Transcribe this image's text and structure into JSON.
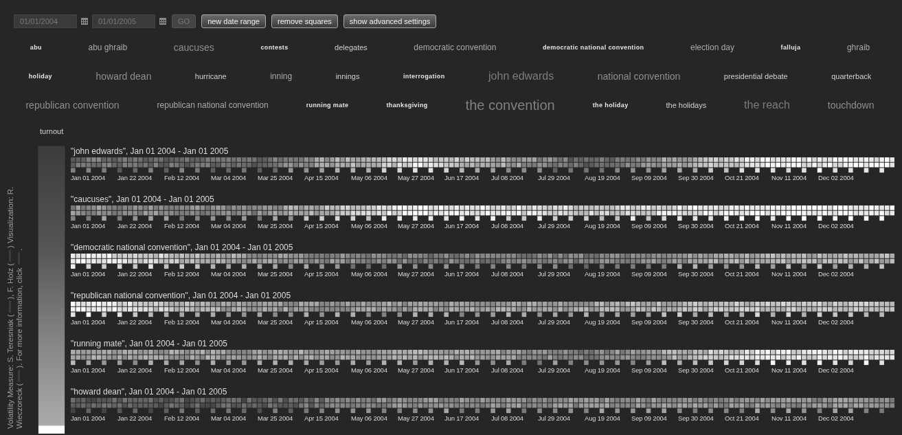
{
  "date_bar": {
    "start_date": "01/01/2004",
    "end_date": "01/01/2005",
    "go_button": {
      "label": "GO",
      "disabled": true
    },
    "buttons": [
      "new date range",
      "remove squares",
      "show advanced settings"
    ]
  },
  "tag_rows": [
    [
      {
        "label": "abu",
        "kind": "strong"
      },
      {
        "label": "abu ghraib",
        "kind": "plain"
      },
      {
        "label": "caucuses",
        "kind": "faint"
      },
      {
        "label": "contests",
        "kind": "strong"
      },
      {
        "label": "delegates",
        "kind": "light"
      },
      {
        "label": "democratic convention",
        "kind": "plain"
      },
      {
        "label": "democratic national convention",
        "kind": "strong"
      },
      {
        "label": "election day",
        "kind": "plain"
      },
      {
        "label": "falluja",
        "kind": "strong"
      },
      {
        "label": "ghraib",
        "kind": "plain"
      }
    ],
    [
      {
        "label": "holiday",
        "kind": "strong"
      },
      {
        "label": "howard dean",
        "kind": "faint"
      },
      {
        "label": "hurricane",
        "kind": "light"
      },
      {
        "label": "inning",
        "kind": "plain"
      },
      {
        "label": "innings",
        "kind": "light"
      },
      {
        "label": "interrogation",
        "kind": "strong"
      },
      {
        "label": "john edwards",
        "kind": "large"
      },
      {
        "label": "national convention",
        "kind": "faint"
      },
      {
        "label": "presidential debate",
        "kind": "light"
      },
      {
        "label": "quarterback",
        "kind": "light"
      }
    ],
    [
      {
        "label": "republican convention",
        "kind": "faint"
      },
      {
        "label": "republican national convention",
        "kind": "plain"
      },
      {
        "label": "running mate",
        "kind": "strong"
      },
      {
        "label": "thanksgiving",
        "kind": "strong"
      },
      {
        "label": "the convention",
        "kind": "huge"
      },
      {
        "label": "the holiday",
        "kind": "strong"
      },
      {
        "label": "the holidays",
        "kind": "light"
      },
      {
        "label": "the reach",
        "kind": "large"
      },
      {
        "label": "touchdown",
        "kind": "faint"
      }
    ],
    [
      {
        "label": "turnout",
        "kind": "light"
      }
    ]
  ],
  "credits": [
    [
      {
        "kind": "text",
        "text": "Volatility Measure: S. Teresniak ("
      },
      {
        "kind": "link"
      },
      {
        "kind": "text",
        "text": "), F. Holz ("
      },
      {
        "kind": "link"
      },
      {
        "kind": "text",
        "text": ") Visualization: R."
      }
    ],
    [
      {
        "kind": "text",
        "text": "Wieczoreck ("
      },
      {
        "kind": "link"
      },
      {
        "kind": "text",
        "text": "). For more information, click "
      },
      {
        "kind": "link"
      },
      {
        "kind": "text",
        "text": "."
      }
    ]
  ],
  "panels": [
    {
      "title": "\"john edwards\", Jan 01 2004 - Jan 01 2005",
      "date_labels": [
        "Jan 01 2004",
        "Jan 22 2004",
        "Feb 12 2004",
        "Mar 04 2004",
        "Mar 25 2004",
        "Apr 15 2004",
        "May 06 2004",
        "May 27 2004",
        "Jun 17 2004",
        "Jul 08 2004",
        "Jul 29 2004",
        "Aug 19 2004",
        "Sep 09 2004",
        "Sep 30 2004",
        "Oct 21 2004",
        "Nov 11 2004",
        "Dec 02 2004"
      ]
    },
    {
      "title": "\"caucuses\", Jan 01 2004 - Jan 01 2005",
      "date_labels": [
        "Jan 01 2004",
        "Jan 22 2004",
        "Feb 12 2004",
        "Mar 04 2004",
        "Mar 25 2004",
        "Apr 15 2004",
        "May 06 2004",
        "May 27 2004",
        "Jun 17 2004",
        "Jul 08 2004",
        "Jul 29 2004",
        "Aug 19 2004",
        "Sep 09 2004",
        "Sep 30 2004",
        "Oct 21 2004",
        "Nov 11 2004",
        "Dec 02 2004"
      ]
    },
    {
      "title": "\"democratic national convention\", Jan 01 2004 - Jan 01 2005",
      "date_labels": [
        "Jan 01 2004",
        "Jan 22 2004",
        "Feb 12 2004",
        "Mar 04 2004",
        "Mar 25 2004",
        "Apr 15 2004",
        "May 06 2004",
        "May 27 2004",
        "Jun 17 2004",
        "Jul 08 2004",
        "Jul 29 2004",
        "Aug 19 2004",
        "Sep 09 2004",
        "Sep 30 2004",
        "Oct 21 2004",
        "Nov 11 2004",
        "Dec 02 2004"
      ]
    },
    {
      "title": "\"republican national convention\", Jan 01 2004 - Jan 01 2005",
      "date_labels": [
        "Jan 01 2004",
        "Jan 22 2004",
        "Feb 12 2004",
        "Mar 04 2004",
        "Mar 25 2004",
        "Apr 15 2004",
        "May 06 2004",
        "May 27 2004",
        "Jun 17 2004",
        "Jul 08 2004",
        "Jul 29 2004",
        "Aug 19 2004",
        "Sep 09 2004",
        "Sep 30 2004",
        "Oct 21 2004",
        "Nov 11 2004",
        "Dec 02 2004"
      ]
    },
    {
      "title": "\"running mate\", Jan 01 2004 - Jan 01 2005",
      "date_labels": [
        "Jan 01 2004",
        "Jan 22 2004",
        "Feb 12 2004",
        "Mar 04 2004",
        "Mar 25 2004",
        "Apr 15 2004",
        "May 06 2004",
        "May 27 2004",
        "Jun 17 2004",
        "Jul 08 2004",
        "Jul 29 2004",
        "Aug 19 2004",
        "Sep 09 2004",
        "Sep 30 2004",
        "Oct 21 2004",
        "Nov 11 2004",
        "Dec 02 2004"
      ]
    },
    {
      "title": "\"howard dean\", Jan 01 2004 - Jan 01 2005",
      "date_labels": [
        "Jan 01 2004",
        "Jan 22 2004",
        "Feb 12 2004",
        "Mar 04 2004",
        "Mar 25 2004",
        "Apr 15 2004",
        "May 06 2004",
        "May 27 2004",
        "Jun 17 2004",
        "Jul 08 2004",
        "Jul 29 2004",
        "Aug 19 2004",
        "Sep 09 2004",
        "Sep 30 2004",
        "Oct 21 2004",
        "Nov 11 2004",
        "Dec 02 2004"
      ]
    }
  ]
}
